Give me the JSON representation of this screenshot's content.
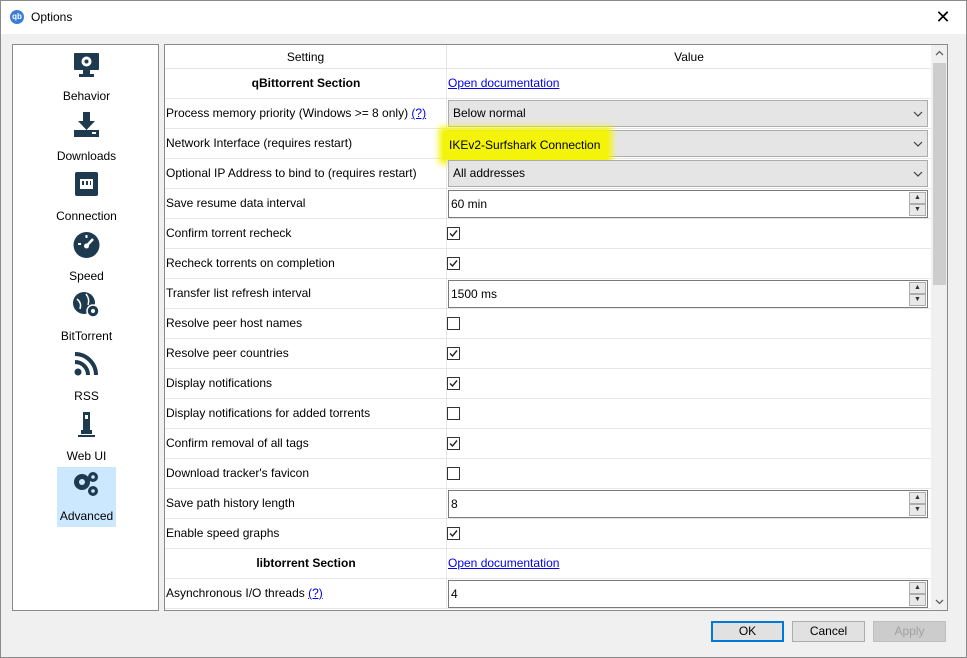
{
  "window": {
    "title": "Options",
    "close": "✕",
    "app_icon": "qb"
  },
  "sidebar": {
    "items": [
      {
        "label": "Behavior",
        "icon": "monitor-gear-icon",
        "selected": true
      },
      {
        "label": "Downloads",
        "icon": "download-icon",
        "selected": false
      },
      {
        "label": "Connection",
        "icon": "network-port-icon",
        "selected": false
      },
      {
        "label": "Speed",
        "icon": "speedometer-icon",
        "selected": false
      },
      {
        "label": "BitTorrent",
        "icon": "globe-gear-icon",
        "selected": false
      },
      {
        "label": "RSS",
        "icon": "rss-icon",
        "selected": false
      },
      {
        "label": "Web UI",
        "icon": "usb-stick-icon",
        "selected": false
      },
      {
        "label": "Advanced",
        "icon": "gears-icon",
        "selected": true
      }
    ]
  },
  "table": {
    "header": {
      "setting": "Setting",
      "value": "Value"
    },
    "rows": [
      {
        "setting": "qBittorrent Section",
        "type": "section",
        "value": "Open documentation"
      },
      {
        "setting": "Process memory priority (Windows >= 8 only)",
        "help": "(?)",
        "type": "combo",
        "value": "Below normal"
      },
      {
        "setting": "Network Interface (requires restart)",
        "type": "combo",
        "value": "IKEv2-Surfshark Connection",
        "highlight": true
      },
      {
        "setting": "Optional IP Address to bind to (requires restart)",
        "type": "combo",
        "value": "All addresses"
      },
      {
        "setting": "Save resume data interval",
        "type": "spin",
        "value": "60 min"
      },
      {
        "setting": "Confirm torrent recheck",
        "type": "check",
        "checked": true
      },
      {
        "setting": "Recheck torrents on completion",
        "type": "check",
        "checked": true
      },
      {
        "setting": "Transfer list refresh interval",
        "type": "spin",
        "value": "1500 ms"
      },
      {
        "setting": "Resolve peer host names",
        "type": "check",
        "checked": false
      },
      {
        "setting": "Resolve peer countries",
        "type": "check",
        "checked": true
      },
      {
        "setting": "Display notifications",
        "type": "check",
        "checked": true
      },
      {
        "setting": "Display notifications for added torrents",
        "type": "check",
        "checked": false
      },
      {
        "setting": "Confirm removal of all tags",
        "type": "check",
        "checked": true
      },
      {
        "setting": "Download tracker's favicon",
        "type": "check",
        "checked": false
      },
      {
        "setting": "Save path history length",
        "type": "spin",
        "value": "8"
      },
      {
        "setting": "Enable speed graphs",
        "type": "check",
        "checked": true
      },
      {
        "setting": "libtorrent Section",
        "type": "section",
        "value": "Open documentation"
      },
      {
        "setting": "Asynchronous I/O threads",
        "help": "(?)",
        "type": "spin",
        "value": "4"
      }
    ]
  },
  "buttons": {
    "ok": "OK",
    "cancel": "Cancel",
    "apply": "Apply"
  },
  "colors": {
    "accent": "#0078d7",
    "selection": "#cce8ff",
    "highlight": "#f4f40a",
    "link": "#0000ee"
  }
}
